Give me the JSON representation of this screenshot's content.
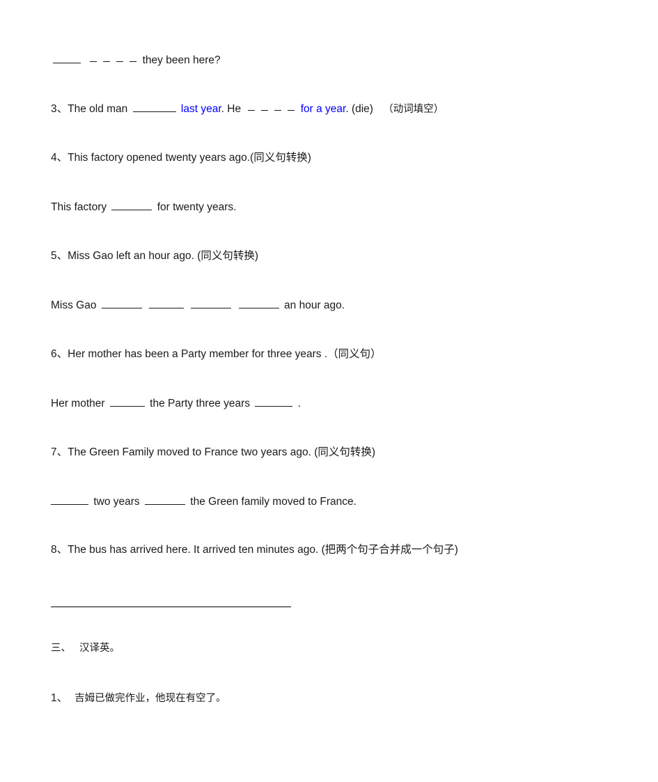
{
  "document": {
    "type": "worksheet",
    "language": "en-zh",
    "accent_color": "#0000ff",
    "text_color": "#1a1a1a"
  },
  "section_two_tail": {
    "q2_continuation": {
      "blank_before": "____",
      "dashes": "_ _ _ _",
      "text": "they been here?"
    },
    "q3": {
      "number": "3、",
      "part1": "The old man",
      "answer_hint_1": "last year",
      "part2": ". He",
      "answer_hint_2": "for a year",
      "part3": ". (die)",
      "instruction": "（动词填空）"
    },
    "q4": {
      "number": "4、",
      "prompt": "This factory opened twenty years ago.(同义句转换)",
      "answer_prefix": "This factory",
      "answer_suffix": "for twenty years."
    },
    "q5": {
      "number": "5、",
      "prompt": "Miss Gao left an hour ago. (同义句转换)",
      "answer_prefix": "Miss Gao",
      "answer_suffix": "an hour ago."
    },
    "q6": {
      "number": "6、",
      "prompt": "Her mother has been a Party member for three years .（同义句）",
      "answer_prefix": "Her mother",
      "answer_middle": "the Party three years",
      "answer_suffix": "."
    },
    "q7": {
      "number": "7、",
      "prompt": "The Green Family moved to France two years ago. (同义句转换)",
      "answer_middle": "two years",
      "answer_suffix": "the Green family moved to France."
    },
    "q8": {
      "number": "8、",
      "prompt": "The bus has arrived here. It arrived ten minutes ago. (把两个句子合并成一个句子)"
    }
  },
  "section_three": {
    "heading_number": "三、",
    "heading_title": "汉译英。",
    "items": [
      {
        "number": "1、",
        "text": "吉姆已做完作业，他现在有空了。"
      }
    ]
  }
}
